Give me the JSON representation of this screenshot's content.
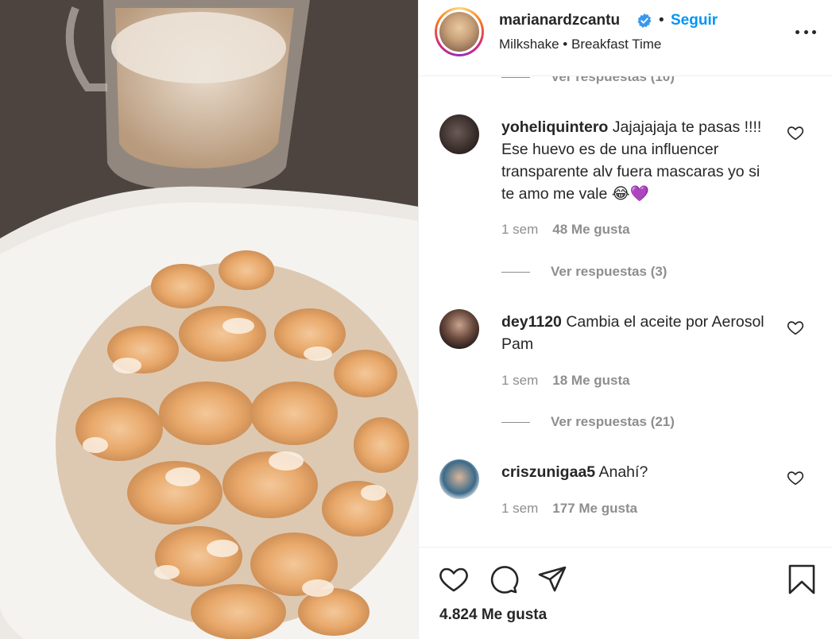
{
  "post": {
    "username": "marianardzcantu",
    "follow_label": "Seguir",
    "separator": "•",
    "location": "Milkshake • Breakfast Time",
    "likes_total": "4.824 Me gusta"
  },
  "comments": {
    "top_view_replies": "Ver respuestas (10)",
    "items": [
      {
        "username": "yoheliquintero",
        "text": "Jajajajaja te pasas !!!! Ese huevo es de una influencer transparente alv fuera mascaras yo si te amo me vale 😂💜",
        "time": "1 sem",
        "likes": "48 Me gusta",
        "view_replies": "Ver respuestas (3)"
      },
      {
        "username": "dey1120",
        "text": "Cambia el aceite por Aerosol Pam",
        "time": "1 sem",
        "likes": "18 Me gusta",
        "view_replies": "Ver respuestas (21)"
      },
      {
        "username": "criszunigaa5",
        "text": "Anahí?",
        "time": "1 sem",
        "likes": "177 Me gusta"
      }
    ]
  },
  "icons": {
    "verified": "verified-badge-icon",
    "more": "more-options-icon",
    "heart": "heart-icon",
    "comment": "comment-icon",
    "share": "share-icon",
    "save": "bookmark-icon"
  },
  "colors": {
    "link_blue": "#0095f6",
    "text": "#262626",
    "muted": "#8e8e8e",
    "border": "#efefef"
  }
}
